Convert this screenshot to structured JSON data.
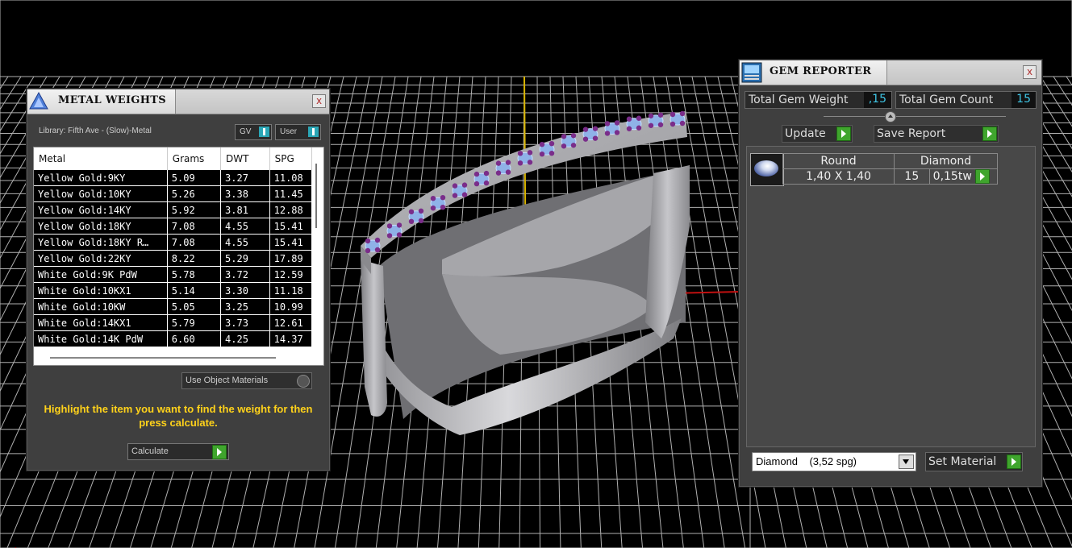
{
  "metal_weights": {
    "title": "METAL WEIGHTS",
    "close": "x",
    "library_label": "Library: Fifth Ave - (Slow)-Metal",
    "gv_toggle": "GV",
    "user_toggle": "User",
    "columns": [
      "Metal",
      "Grams",
      "DWT",
      "SPG"
    ],
    "rows": [
      {
        "metal": "Yellow Gold:9KY",
        "grams": "5.09",
        "dwt": "3.27",
        "spg": "11.08"
      },
      {
        "metal": "Yellow Gold:10KY",
        "grams": "5.26",
        "dwt": "3.38",
        "spg": "11.45"
      },
      {
        "metal": "Yellow Gold:14KY",
        "grams": "5.92",
        "dwt": "3.81",
        "spg": "12.88"
      },
      {
        "metal": "Yellow Gold:18KY",
        "grams": "7.08",
        "dwt": "4.55",
        "spg": "15.41"
      },
      {
        "metal": "Yellow Gold:18KY R…",
        "grams": "7.08",
        "dwt": "4.55",
        "spg": "15.41"
      },
      {
        "metal": "Yellow Gold:22KY",
        "grams": "8.22",
        "dwt": "5.29",
        "spg": "17.89"
      },
      {
        "metal": "White Gold:9K PdW",
        "grams": "5.78",
        "dwt": "3.72",
        "spg": "12.59"
      },
      {
        "metal": "White Gold:10KX1",
        "grams": "5.14",
        "dwt": "3.30",
        "spg": "11.18"
      },
      {
        "metal": "White Gold:10KW",
        "grams": "5.05",
        "dwt": "3.25",
        "spg": "10.99"
      },
      {
        "metal": "White Gold:14KX1",
        "grams": "5.79",
        "dwt": "3.73",
        "spg": "12.61"
      },
      {
        "metal": "White Gold:14K PdW",
        "grams": "6.60",
        "dwt": "4.25",
        "spg": "14.37"
      }
    ],
    "use_object_materials": "Use Object Materials",
    "instruction": "Highlight the item you want to find the weight for then press calculate.",
    "calculate": "Calculate"
  },
  "gem_reporter": {
    "title": "GEM REPORTER",
    "close": "x",
    "total_gem_weight_label": "Total Gem Weight",
    "total_gem_weight_value": ",15",
    "total_gem_count_label": "Total Gem Count",
    "total_gem_count_value": "15",
    "update": "Update",
    "save_report": "Save Report",
    "gem_rows": [
      {
        "shape": "Round",
        "material": "Diamond",
        "size": "1,40 X 1,40",
        "count": "15",
        "weight": "0,15tw"
      }
    ],
    "material_select": "Diamond    (3,52 spg)",
    "set_material": "Set Material"
  },
  "colors": {
    "accent_green": "#3fa52d",
    "value_cyan": "#3fc6e6",
    "instruction_yellow": "#ffd21a",
    "panel_bg": "#3f3f3f"
  }
}
